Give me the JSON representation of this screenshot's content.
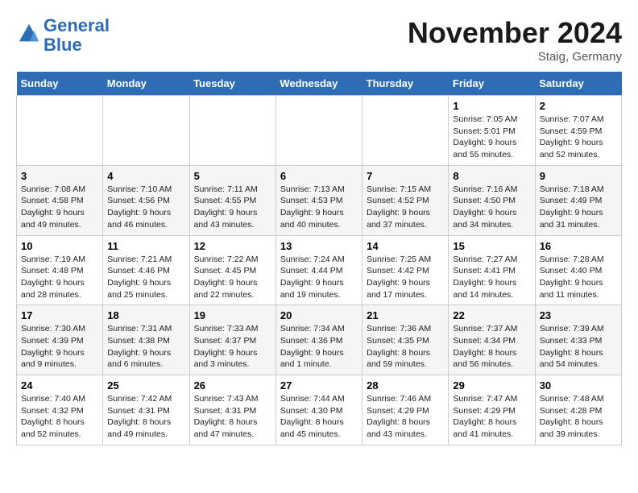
{
  "header": {
    "logo_line1": "General",
    "logo_line2": "Blue",
    "title": "November 2024",
    "subtitle": "Staig, Germany"
  },
  "calendar": {
    "days_of_week": [
      "Sunday",
      "Monday",
      "Tuesday",
      "Wednesday",
      "Thursday",
      "Friday",
      "Saturday"
    ],
    "weeks": [
      [
        {
          "day": "",
          "info": ""
        },
        {
          "day": "",
          "info": ""
        },
        {
          "day": "",
          "info": ""
        },
        {
          "day": "",
          "info": ""
        },
        {
          "day": "",
          "info": ""
        },
        {
          "day": "1",
          "info": "Sunrise: 7:05 AM\nSunset: 5:01 PM\nDaylight: 9 hours and 55 minutes."
        },
        {
          "day": "2",
          "info": "Sunrise: 7:07 AM\nSunset: 4:59 PM\nDaylight: 9 hours and 52 minutes."
        }
      ],
      [
        {
          "day": "3",
          "info": "Sunrise: 7:08 AM\nSunset: 4:58 PM\nDaylight: 9 hours and 49 minutes."
        },
        {
          "day": "4",
          "info": "Sunrise: 7:10 AM\nSunset: 4:56 PM\nDaylight: 9 hours and 46 minutes."
        },
        {
          "day": "5",
          "info": "Sunrise: 7:11 AM\nSunset: 4:55 PM\nDaylight: 9 hours and 43 minutes."
        },
        {
          "day": "6",
          "info": "Sunrise: 7:13 AM\nSunset: 4:53 PM\nDaylight: 9 hours and 40 minutes."
        },
        {
          "day": "7",
          "info": "Sunrise: 7:15 AM\nSunset: 4:52 PM\nDaylight: 9 hours and 37 minutes."
        },
        {
          "day": "8",
          "info": "Sunrise: 7:16 AM\nSunset: 4:50 PM\nDaylight: 9 hours and 34 minutes."
        },
        {
          "day": "9",
          "info": "Sunrise: 7:18 AM\nSunset: 4:49 PM\nDaylight: 9 hours and 31 minutes."
        }
      ],
      [
        {
          "day": "10",
          "info": "Sunrise: 7:19 AM\nSunset: 4:48 PM\nDaylight: 9 hours and 28 minutes."
        },
        {
          "day": "11",
          "info": "Sunrise: 7:21 AM\nSunset: 4:46 PM\nDaylight: 9 hours and 25 minutes."
        },
        {
          "day": "12",
          "info": "Sunrise: 7:22 AM\nSunset: 4:45 PM\nDaylight: 9 hours and 22 minutes."
        },
        {
          "day": "13",
          "info": "Sunrise: 7:24 AM\nSunset: 4:44 PM\nDaylight: 9 hours and 19 minutes."
        },
        {
          "day": "14",
          "info": "Sunrise: 7:25 AM\nSunset: 4:42 PM\nDaylight: 9 hours and 17 minutes."
        },
        {
          "day": "15",
          "info": "Sunrise: 7:27 AM\nSunset: 4:41 PM\nDaylight: 9 hours and 14 minutes."
        },
        {
          "day": "16",
          "info": "Sunrise: 7:28 AM\nSunset: 4:40 PM\nDaylight: 9 hours and 11 minutes."
        }
      ],
      [
        {
          "day": "17",
          "info": "Sunrise: 7:30 AM\nSunset: 4:39 PM\nDaylight: 9 hours and 9 minutes."
        },
        {
          "day": "18",
          "info": "Sunrise: 7:31 AM\nSunset: 4:38 PM\nDaylight: 9 hours and 6 minutes."
        },
        {
          "day": "19",
          "info": "Sunrise: 7:33 AM\nSunset: 4:37 PM\nDaylight: 9 hours and 3 minutes."
        },
        {
          "day": "20",
          "info": "Sunrise: 7:34 AM\nSunset: 4:36 PM\nDaylight: 9 hours and 1 minute."
        },
        {
          "day": "21",
          "info": "Sunrise: 7:36 AM\nSunset: 4:35 PM\nDaylight: 8 hours and 59 minutes."
        },
        {
          "day": "22",
          "info": "Sunrise: 7:37 AM\nSunset: 4:34 PM\nDaylight: 8 hours and 56 minutes."
        },
        {
          "day": "23",
          "info": "Sunrise: 7:39 AM\nSunset: 4:33 PM\nDaylight: 8 hours and 54 minutes."
        }
      ],
      [
        {
          "day": "24",
          "info": "Sunrise: 7:40 AM\nSunset: 4:32 PM\nDaylight: 8 hours and 52 minutes."
        },
        {
          "day": "25",
          "info": "Sunrise: 7:42 AM\nSunset: 4:31 PM\nDaylight: 8 hours and 49 minutes."
        },
        {
          "day": "26",
          "info": "Sunrise: 7:43 AM\nSunset: 4:31 PM\nDaylight: 8 hours and 47 minutes."
        },
        {
          "day": "27",
          "info": "Sunrise: 7:44 AM\nSunset: 4:30 PM\nDaylight: 8 hours and 45 minutes."
        },
        {
          "day": "28",
          "info": "Sunrise: 7:46 AM\nSunset: 4:29 PM\nDaylight: 8 hours and 43 minutes."
        },
        {
          "day": "29",
          "info": "Sunrise: 7:47 AM\nSunset: 4:29 PM\nDaylight: 8 hours and 41 minutes."
        },
        {
          "day": "30",
          "info": "Sunrise: 7:48 AM\nSunset: 4:28 PM\nDaylight: 8 hours and 39 minutes."
        }
      ]
    ]
  }
}
